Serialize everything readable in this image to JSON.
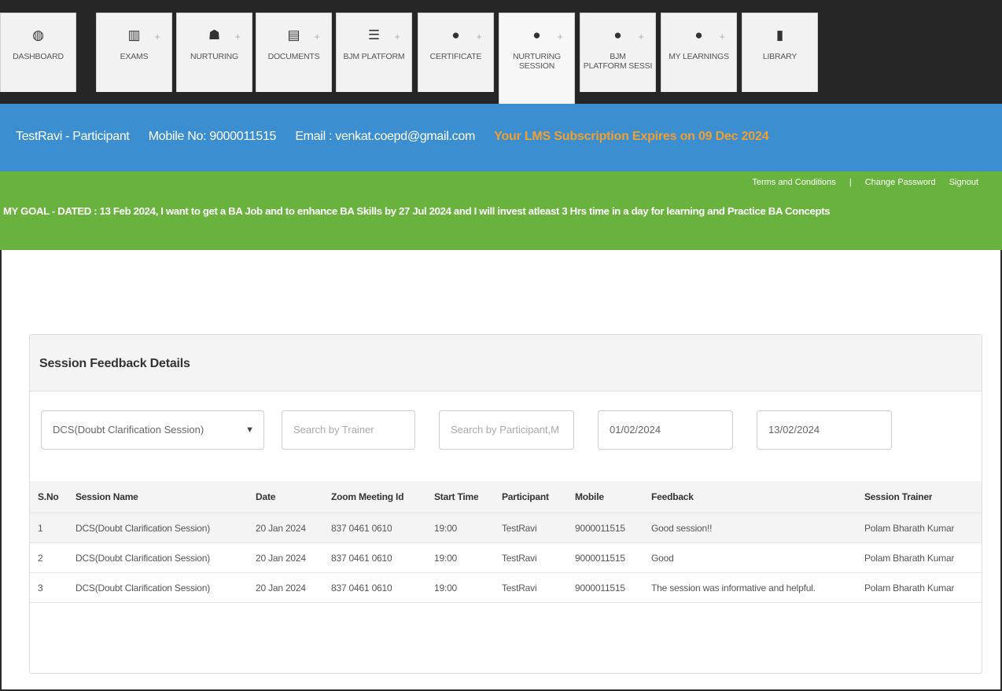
{
  "nav": {
    "tabs": [
      {
        "label": "DASHBOARD",
        "icon": "dashboard-icon",
        "glyph": "◍",
        "plus": false
      },
      {
        "label": "EXAMS",
        "icon": "chart-icon",
        "glyph": "▥",
        "plus": true
      },
      {
        "label": "NURTURING",
        "icon": "users-icon",
        "glyph": "☗",
        "plus": true
      },
      {
        "label": "DOCUMENTS",
        "icon": "document-icon",
        "glyph": "▤",
        "plus": true
      },
      {
        "label": "BJM PLATFORM",
        "icon": "list-icon",
        "glyph": "☰",
        "plus": true
      },
      {
        "label": "CERTIFICATE",
        "icon": "circle-icon",
        "glyph": "●",
        "plus": true
      },
      {
        "label": "NURTURING\nSESSION",
        "icon": "circle-icon",
        "glyph": "●",
        "plus": true,
        "active": true
      },
      {
        "label": "BJM\nPLATFORM SESSI",
        "icon": "circle-icon",
        "glyph": "●",
        "plus": true
      },
      {
        "label": "MY LEARNINGS",
        "icon": "circle-icon",
        "glyph": "●",
        "plus": true
      },
      {
        "label": "LIBRARY",
        "icon": "book-icon",
        "glyph": "▮",
        "plus": false
      }
    ]
  },
  "user": {
    "name_role": "TestRavi - Participant",
    "mobile": "Mobile No: 9000011515",
    "email": "Email : venkat.coepd@gmail.com",
    "expiry": "Your LMS Subscription Expires on 09 Dec 2024"
  },
  "links": {
    "terms": "Terms and Conditions",
    "change_password": "Change Password",
    "signout": "Signout"
  },
  "goal": "MY GOAL - DATED : 13 Feb 2024, I want to get a BA Job and to enhance BA Skills by 27 Jul 2024 and I will invest atleast 3 Hrs time in a day for learning and Practice BA Concepts",
  "panel": {
    "title": "Session Feedback Details",
    "filters": {
      "session_type": "DCS(Doubt Clarification Session)",
      "trainer_placeholder": "Search by Trainer",
      "participant_placeholder": "Search by Participant,M",
      "from_date": "01/02/2024",
      "to_date": "13/02/2024"
    },
    "columns": [
      "S.No",
      "Session Name",
      "Date",
      "Zoom Meeting Id",
      "Start Time",
      "Participant",
      "Mobile",
      "Feedback",
      "Session Trainer"
    ],
    "rows": [
      [
        "1",
        "DCS(Doubt Clarification Session)",
        "20 Jan 2024",
        "837 0461 0610",
        "19:00",
        "TestRavi",
        "9000011515",
        "Good session!!",
        "Polam Bharath Kumar"
      ],
      [
        "2",
        "DCS(Doubt Clarification Session)",
        "20 Jan 2024",
        "837 0461 0610",
        "19:00",
        "TestRavi",
        "9000011515",
        "Good",
        "Polam Bharath Kumar"
      ],
      [
        "3",
        "DCS(Doubt Clarification Session)",
        "20 Jan 2024",
        "837 0461 0610",
        "19:00",
        "TestRavi",
        "9000011515",
        "The session was informative and helpful.",
        "Polam Bharath Kumar"
      ]
    ]
  },
  "colors": {
    "nav_bg": "#262626",
    "blue_bar": "#3b8fd0",
    "green_bar": "#6ab23e",
    "expiry_text": "#f0a030"
  }
}
